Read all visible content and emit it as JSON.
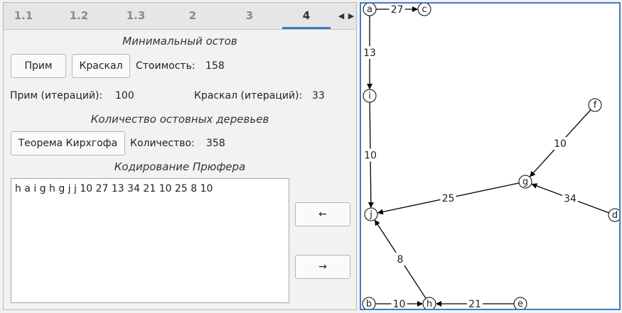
{
  "tabs": [
    "1.1",
    "1.2",
    "1.3",
    "2",
    "3",
    "4"
  ],
  "active_tab": "4",
  "tab_scroll": {
    "left": "◀",
    "right": "▶"
  },
  "mst": {
    "title": "Минимальный остов",
    "prim_button": "Прим",
    "kruskal_button": "Краскал",
    "cost_label": "Стоимость:",
    "cost_value": "158",
    "prim_iter_label": "Прим (итераций):",
    "prim_iter_value": "100",
    "kruskal_iter_label": "Краскал (итераций):",
    "kruskal_iter_value": "33"
  },
  "spanning": {
    "title": "Количество остовных деревьев",
    "kirchhoff_button": "Теорема Кирхгофа",
    "count_label": "Количество:",
    "count_value": "358"
  },
  "prufer": {
    "title": "Кодирование Прюфера",
    "code_text": "h a i g h g j j 10 27 13 34 21 10 25 8 10",
    "prev_button": "←",
    "next_button": "→"
  },
  "graph": {
    "nodes": [
      {
        "id": "a"
      },
      {
        "id": "c"
      },
      {
        "id": "i"
      },
      {
        "id": "f"
      },
      {
        "id": "g"
      },
      {
        "id": "j"
      },
      {
        "id": "d"
      },
      {
        "id": "b"
      },
      {
        "id": "h"
      },
      {
        "id": "e"
      }
    ],
    "edges": [
      {
        "from": "a",
        "to": "c",
        "weight": "27"
      },
      {
        "from": "a",
        "to": "i",
        "weight": "13"
      },
      {
        "from": "i",
        "to": "j",
        "weight": "10"
      },
      {
        "from": "f",
        "to": "g",
        "weight": "10"
      },
      {
        "from": "g",
        "to": "j",
        "weight": "25"
      },
      {
        "from": "d",
        "to": "g",
        "weight": "34"
      },
      {
        "from": "h",
        "to": "j",
        "weight": "8"
      },
      {
        "from": "b",
        "to": "h",
        "weight": "10"
      },
      {
        "from": "e",
        "to": "h",
        "weight": "21"
      }
    ]
  }
}
